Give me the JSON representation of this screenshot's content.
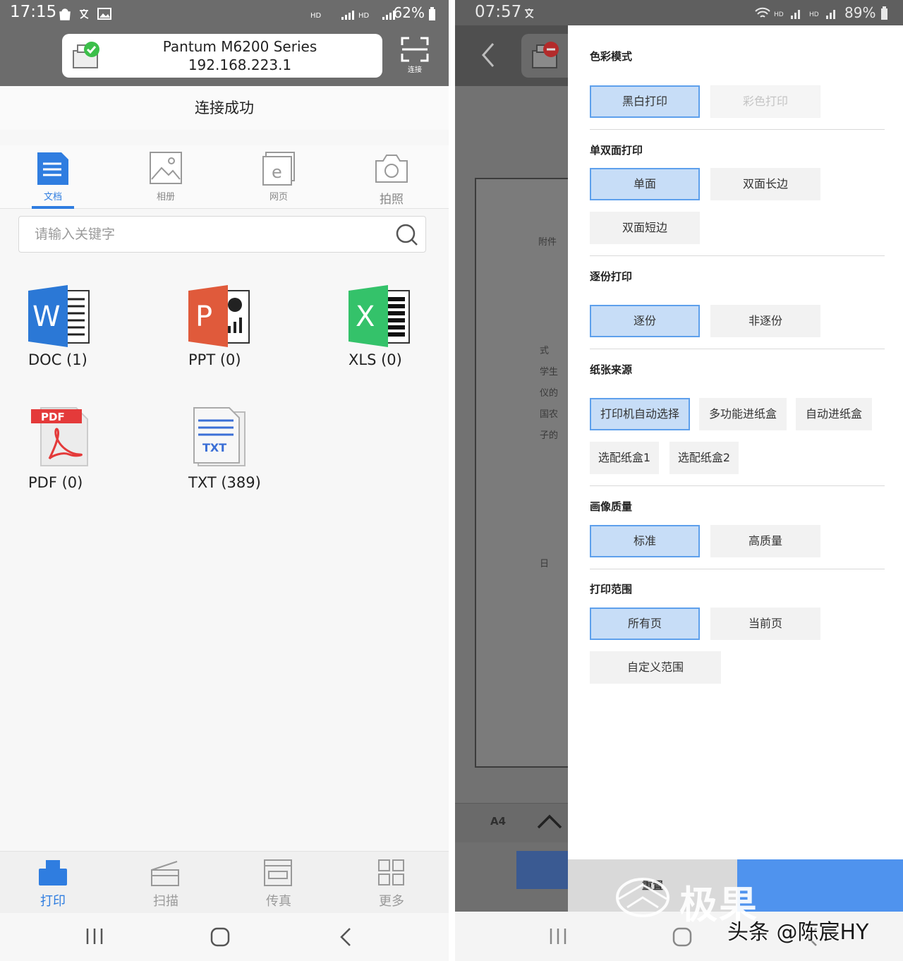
{
  "left": {
    "status": {
      "time": "17:15",
      "battery": "62%"
    },
    "printer": {
      "name": "Pantum M6200 Series",
      "ip": "192.168.223.1",
      "connect_label": "连接"
    },
    "connection_status": "连接成功",
    "tabs": [
      {
        "label": "文档",
        "icon": "document-icon",
        "active": true
      },
      {
        "label": "相册",
        "icon": "image-icon",
        "active": false
      },
      {
        "label": "网页",
        "icon": "browser-icon",
        "active": false
      },
      {
        "label": "拍照",
        "icon": "camera-icon",
        "active": false
      }
    ],
    "search": {
      "placeholder": "请输入关键字"
    },
    "files": [
      {
        "label": "DOC (1)",
        "icon": "word-icon",
        "color": "#2b78d6"
      },
      {
        "label": "PPT (0)",
        "icon": "powerpoint-icon",
        "color": "#e05a3b"
      },
      {
        "label": "XLS (0)",
        "icon": "excel-icon",
        "color": "#34c26a"
      },
      {
        "label": "PDF (0)",
        "icon": "pdf-icon",
        "color": "#e43a3a"
      },
      {
        "label": "TXT (389)",
        "icon": "txt-icon",
        "color": "#3b6fd6"
      }
    ],
    "bottom_nav": [
      {
        "label": "打印",
        "icon": "print-icon",
        "active": true
      },
      {
        "label": "扫描",
        "icon": "scan-icon",
        "active": false
      },
      {
        "label": "传真",
        "icon": "fax-icon",
        "active": false
      },
      {
        "label": "更多",
        "icon": "more-grid-icon",
        "active": false
      }
    ]
  },
  "right": {
    "status": {
      "time": "07:57",
      "battery": "89%"
    },
    "preview": {
      "text_lines": [
        "附件",
        "式",
        "学生",
        "仪的",
        "国农",
        "子的",
        "日"
      ],
      "paper_size": "A4"
    },
    "settings": {
      "color_mode": {
        "title": "色彩模式",
        "options": [
          "黑白打印",
          "彩色打印"
        ],
        "selected": 0,
        "disabled": [
          1
        ]
      },
      "duplex": {
        "title": "单双面打印",
        "options": [
          "单面",
          "双面长边",
          "双面短边"
        ],
        "selected": 0
      },
      "collate": {
        "title": "逐份打印",
        "options": [
          "逐份",
          "非逐份"
        ],
        "selected": 0
      },
      "paper_source": {
        "title": "纸张来源",
        "options": [
          "打印机自动选择",
          "多功能进纸盒",
          "自动进纸盒",
          "选配纸盒1",
          "选配纸盒2"
        ],
        "selected": 0
      },
      "quality": {
        "title": "画像质量",
        "options": [
          "标准",
          "高质量"
        ],
        "selected": 0
      },
      "range": {
        "title": "打印范围",
        "options": [
          "所有页",
          "当前页",
          "自定义范围"
        ],
        "selected": 0
      }
    },
    "footer": {
      "reset_label": "重置"
    }
  },
  "watermark": {
    "brand": "极果",
    "credit": "头条 @陈宸HY"
  },
  "colors": {
    "accent": "#2f7de0",
    "selected_bg": "#c7ddf7",
    "selected_border": "#5ea0ec",
    "header_gray": "#6c6c6c"
  }
}
